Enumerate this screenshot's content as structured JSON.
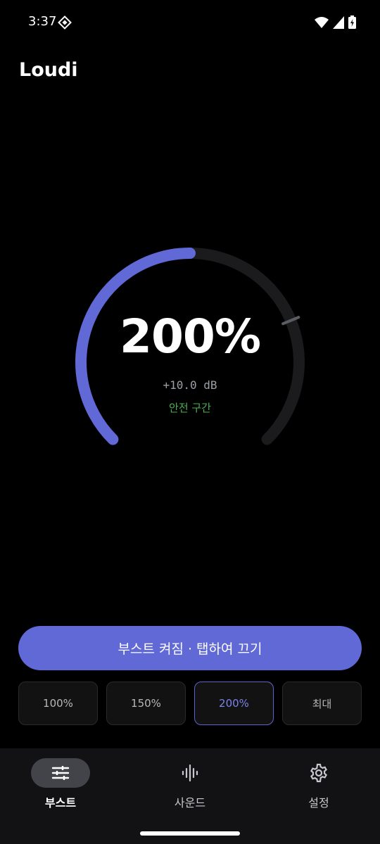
{
  "status_bar": {
    "time": "3:37",
    "icons": [
      "app-notification-icon",
      "wifi-icon",
      "cell-signal-icon",
      "battery-charging-icon"
    ]
  },
  "app": {
    "title": "Loudi"
  },
  "gauge": {
    "value_text": "200%",
    "db_text": "+10.0 dB",
    "zone_text": "안전 구간",
    "level_fraction": 0.5,
    "safe_mark_fraction": 0.75,
    "colors": {
      "fill": "#6169d6",
      "track": "#1b1b1d",
      "zone": "#4caf50"
    }
  },
  "boost_button": {
    "label": "부스트 켜짐 · 탭하여 끄기"
  },
  "presets": [
    {
      "label": "100%",
      "active": false
    },
    {
      "label": "150%",
      "active": false
    },
    {
      "label": "200%",
      "active": true
    },
    {
      "label": "최대",
      "active": false
    }
  ],
  "nav": [
    {
      "label": "부스트",
      "icon": "sliders-icon",
      "active": true
    },
    {
      "label": "사운드",
      "icon": "waveform-icon",
      "active": false
    },
    {
      "label": "설정",
      "icon": "gear-icon",
      "active": false
    }
  ]
}
